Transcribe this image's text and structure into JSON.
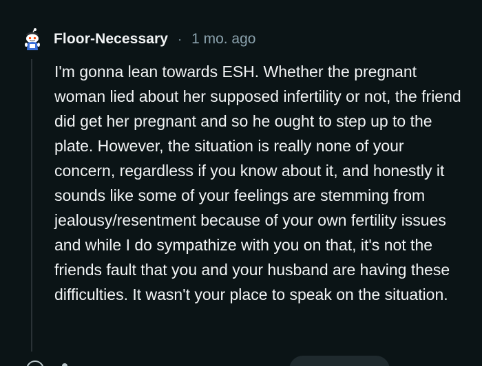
{
  "comment": {
    "author": "Floor-Necessary",
    "separator": "·",
    "timestamp": "1 mo. ago",
    "avatar_icon": "snoo-avatar-icon",
    "body": "I'm gonna lean towards ESH. Whether the pregnant woman lied about her supposed infertility or not, the friend did get her pregnant and so he ought to step up to the plate. However, the situation is really none of your concern, regardless if you know about it, and honestly it sounds like some of your feelings are stemming from jealousy/resentment because of your own fertility issues and while I do sympathize with you on that, it's not the friends fault that you and your husband are having these difficulties. It wasn't your place to speak on the situation."
  },
  "colors": {
    "background": "#0b1416",
    "text": "#f2f4f5",
    "meta": "#8ba2ad",
    "thread_line": "#2a3236"
  }
}
